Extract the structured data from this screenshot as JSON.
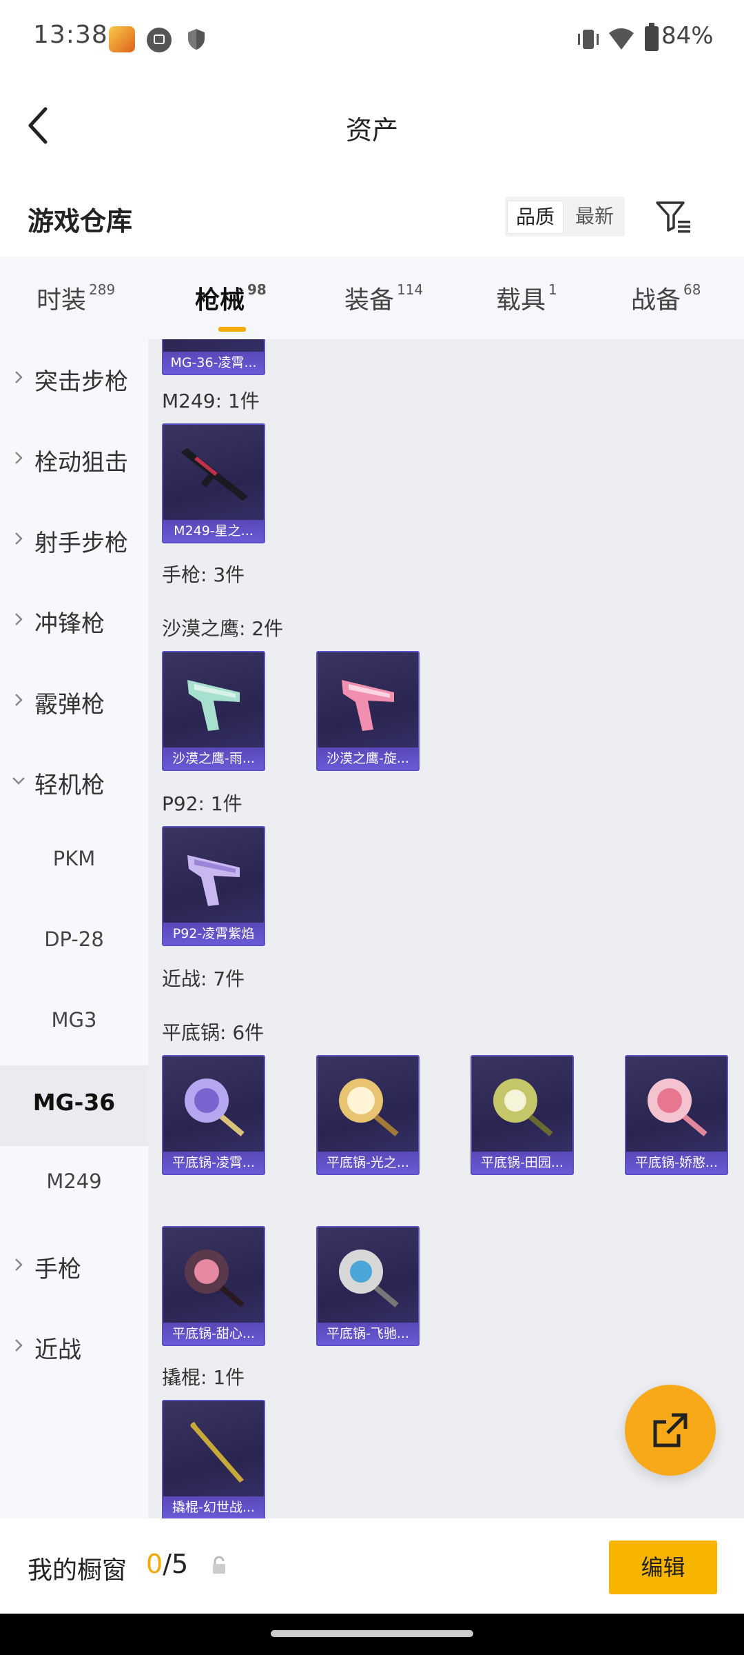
{
  "status_bar": {
    "time": "13:38",
    "battery": "84%"
  },
  "header": {
    "title": "资产"
  },
  "warehouse": {
    "title": "游戏仓库",
    "sort_options": [
      "品质",
      "最新"
    ]
  },
  "tabs": [
    {
      "label": "时装",
      "count": "289"
    },
    {
      "label": "枪械",
      "count": "98"
    },
    {
      "label": "装备",
      "count": "114"
    },
    {
      "label": "载具",
      "count": "1"
    },
    {
      "label": "战备",
      "count": "68"
    }
  ],
  "sidebar": [
    {
      "label": "突击步枪"
    },
    {
      "label": "栓动狙击"
    },
    {
      "label": "射手步枪"
    },
    {
      "label": "冲锋枪"
    },
    {
      "label": "霰弹枪"
    },
    {
      "label": "轻机枪"
    },
    {
      "label": "PKM"
    },
    {
      "label": "DP-28"
    },
    {
      "label": "MG3"
    },
    {
      "label": "MG-36"
    },
    {
      "label": "M249"
    },
    {
      "label": "手枪"
    },
    {
      "label": "近战"
    }
  ],
  "content": {
    "sections": [
      "M249: 1件",
      "手枪: 3件",
      "沙漠之鹰: 2件",
      "P92: 1件",
      "近战: 7件",
      "平底锅: 6件",
      "撬棍: 1件"
    ],
    "items": [
      "MG-36-凌霄...",
      "M249-星之...",
      "沙漠之鹰-雨...",
      "沙漠之鹰-旋...",
      "P92-凌霄紫焰",
      "平底锅-凌霄...",
      "平底锅-光之...",
      "平底锅-田园...",
      "平底锅-娇憨...",
      "平底锅-甜心...",
      "平底锅-飞驰...",
      "撬棍-幻世战..."
    ]
  },
  "bottom_bar": {
    "label": "我的橱窗",
    "current": "0",
    "total": "/5",
    "edit_label": "编辑"
  },
  "colors": {
    "accent": "#f7b500",
    "card_bg": "#2a2550",
    "card_border": "#5b51c7"
  }
}
